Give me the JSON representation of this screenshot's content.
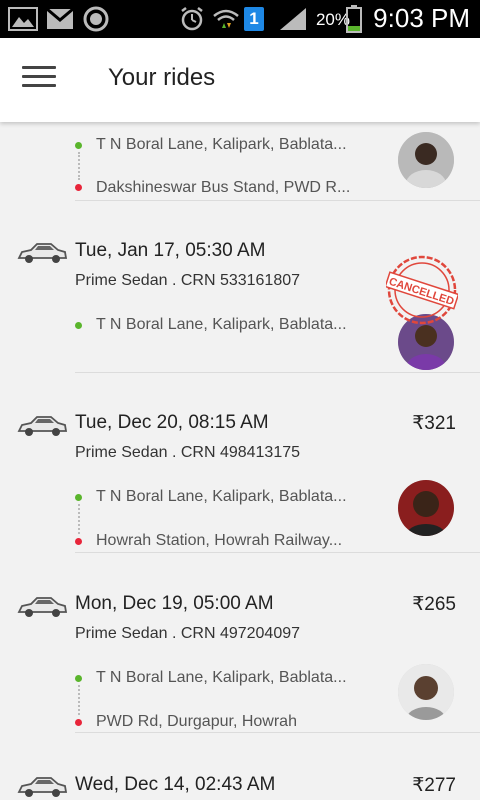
{
  "status_bar": {
    "time": "9:03 PM",
    "battery": "20%",
    "sim_badge": "1"
  },
  "header": {
    "title": "Your rides"
  },
  "rides": [
    {
      "pickup": "T N Boral Lane, Kalipark, Bablata...",
      "drop": "Dakshineswar Bus Stand, PWD R..."
    },
    {
      "date": "Tue, Jan 17, 05:30 AM",
      "detail": "Prime Sedan . CRN 533161807",
      "pickup": "T N Boral Lane, Kalipark, Bablata...",
      "status": "CANCELLED"
    },
    {
      "date": "Tue, Dec 20, 08:15 AM",
      "fare": "₹321",
      "detail": "Prime Sedan . CRN 498413175",
      "pickup": "T N Boral Lane, Kalipark, Bablata...",
      "drop": "Howrah Station, Howrah Railway..."
    },
    {
      "date": "Mon, Dec 19, 05:00 AM",
      "fare": "₹265",
      "detail": "Prime Sedan . CRN 497204097",
      "pickup": "T N Boral Lane, Kalipark, Bablata...",
      "drop": "PWD Rd, Durgapur, Howrah"
    },
    {
      "date": "Wed, Dec 14, 02:43 AM",
      "fare": "₹277"
    }
  ],
  "colors": {
    "pickup_dot": "#5ab52c",
    "drop_dot": "#e8253a",
    "cancel_stamp": "#e0473c"
  }
}
